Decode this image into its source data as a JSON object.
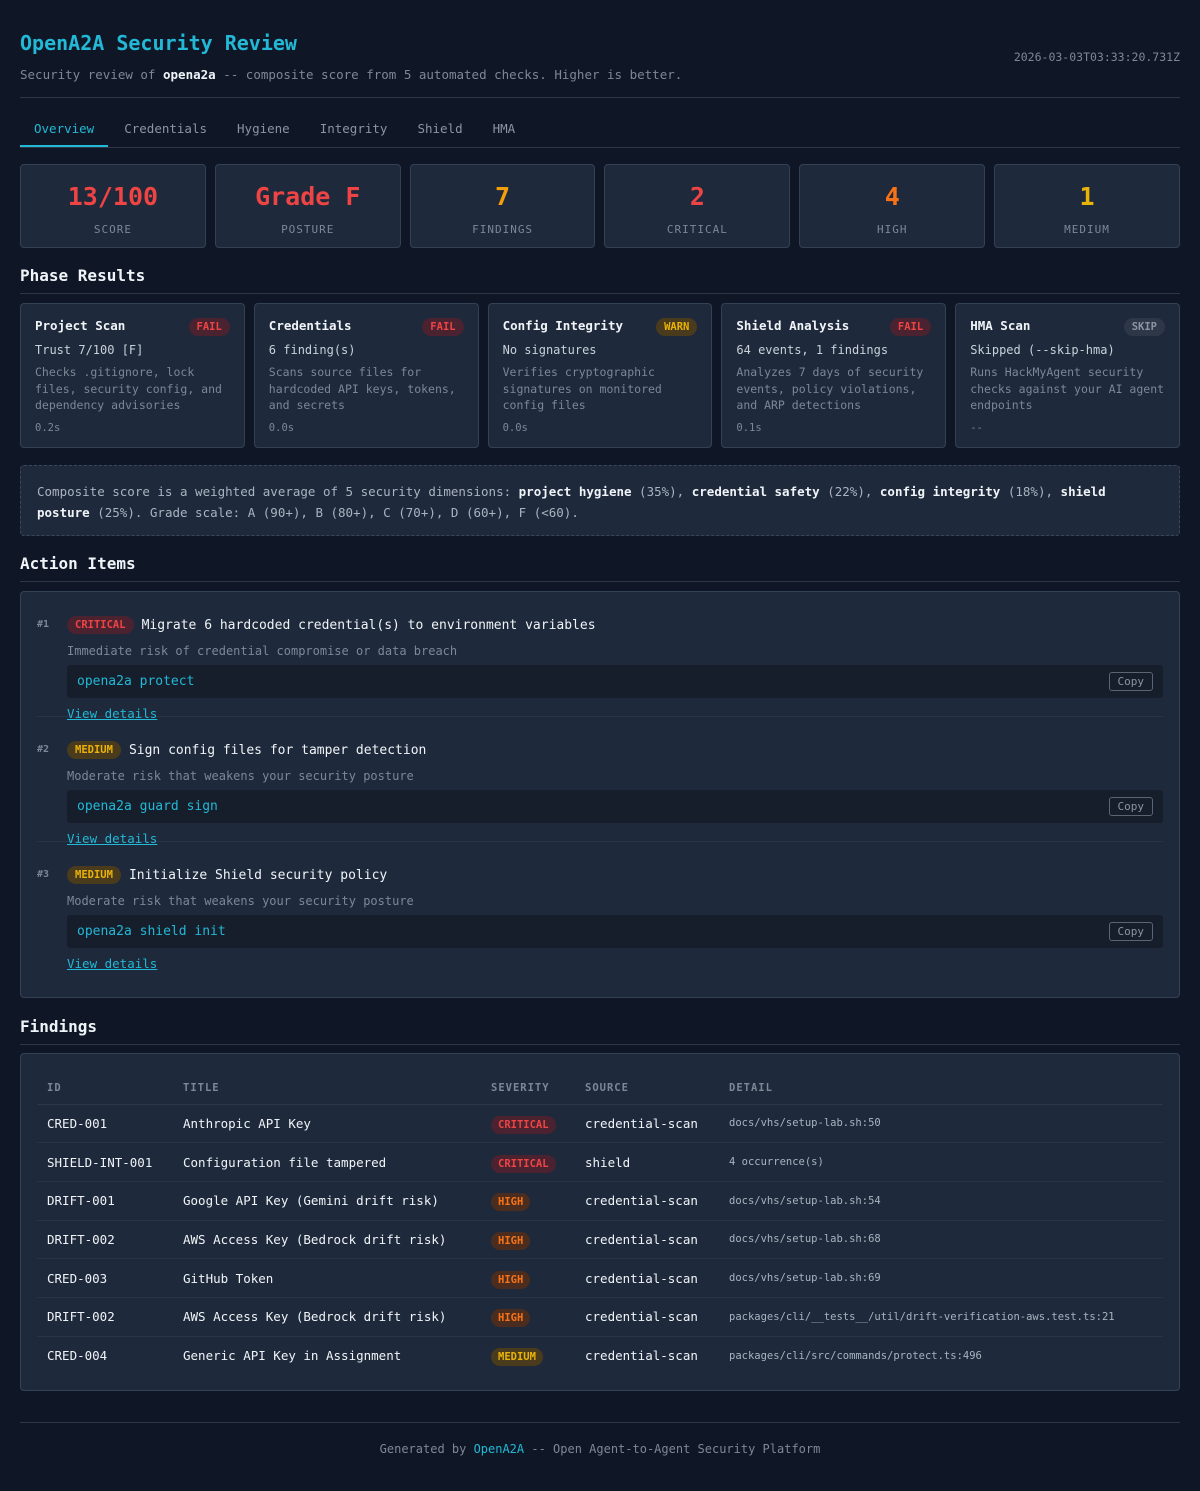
{
  "header": {
    "title": "OpenA2A Security Review",
    "subtitle_prefix": "Security review of ",
    "subtitle_project": "opena2a",
    "subtitle_suffix": " -- composite score from 5 automated checks. Higher is better.",
    "timestamp": "2026-03-03T03:33:20.731Z"
  },
  "tabs": [
    {
      "label": "Overview",
      "active": true
    },
    {
      "label": "Credentials"
    },
    {
      "label": "Hygiene"
    },
    {
      "label": "Integrity"
    },
    {
      "label": "Shield"
    },
    {
      "label": "HMA"
    }
  ],
  "stats": [
    {
      "value": "13/100",
      "label": "SCORE",
      "color": "#ef4444"
    },
    {
      "value": "Grade F",
      "label": "POSTURE",
      "color": "#ef4444"
    },
    {
      "value": "7",
      "label": "FINDINGS",
      "color": "#f59e0b"
    },
    {
      "value": "2",
      "label": "CRITICAL",
      "color": "#ef4444"
    },
    {
      "value": "4",
      "label": "HIGH",
      "color": "#f97316"
    },
    {
      "value": "1",
      "label": "MEDIUM",
      "color": "#eab308"
    }
  ],
  "phase_section_title": "Phase Results",
  "phases": [
    {
      "name": "Project Scan",
      "badge": "FAIL",
      "badge_type": "fail",
      "status": "Trust 7/100 [F]",
      "desc": "Checks .gitignore, lock files, security config, and dependency advisories",
      "time": "0.2s"
    },
    {
      "name": "Credentials",
      "badge": "FAIL",
      "badge_type": "fail",
      "status": "6 finding(s)",
      "desc": "Scans source files for hardcoded API keys, tokens, and secrets",
      "time": "0.0s"
    },
    {
      "name": "Config Integrity",
      "badge": "WARN",
      "badge_type": "warn",
      "status": "No signatures",
      "desc": "Verifies cryptographic signatures on monitored config files",
      "time": "0.0s"
    },
    {
      "name": "Shield Analysis",
      "badge": "FAIL",
      "badge_type": "fail",
      "status": "64 events, 1 findings",
      "desc": "Analyzes 7 days of security events, policy violations, and ARP detections",
      "time": "0.1s"
    },
    {
      "name": "HMA Scan",
      "badge": "SKIP",
      "badge_type": "skip",
      "status": "Skipped (--skip-hma)",
      "desc": "Runs HackMyAgent security checks against your AI agent endpoints",
      "time": "--"
    }
  ],
  "info": {
    "p1": "Composite score is a weighted average of 5 security dimensions: ",
    "d1": "project hygiene",
    "w1": " (35%), ",
    "d2": "credential safety",
    "w2": " (22%), ",
    "d3": "config integrity",
    "w3": " (18%), ",
    "d4": "shield posture",
    "w4": " (25%). Grade scale: A (90+), B (80+), C (70+), D (60+), F (<60)."
  },
  "actions_section_title": "Action Items",
  "actions": [
    {
      "num": "#1",
      "severity": "CRITICAL",
      "sev_type": "crit",
      "title": "Migrate 6 hardcoded credential(s) to environment variables",
      "subtitle": "Immediate risk of credential compromise or data breach",
      "command": "opena2a protect",
      "copy_label": "Copy",
      "link": "View details"
    },
    {
      "num": "#2",
      "severity": "MEDIUM",
      "sev_type": "med",
      "title": "Sign config files for tamper detection",
      "subtitle": "Moderate risk that weakens your security posture",
      "command": "opena2a guard sign",
      "copy_label": "Copy",
      "link": "View details"
    },
    {
      "num": "#3",
      "severity": "MEDIUM",
      "sev_type": "med",
      "title": "Initialize Shield security policy",
      "subtitle": "Moderate risk that weakens your security posture",
      "command": "opena2a shield init",
      "copy_label": "Copy",
      "link": "View details"
    }
  ],
  "findings_section_title": "Findings",
  "findings_columns": [
    "ID",
    "TITLE",
    "SEVERITY",
    "SOURCE",
    "DETAIL"
  ],
  "findings": [
    {
      "id": "CRED-001",
      "title": "Anthropic API Key",
      "severity": "CRITICAL",
      "sev_type": "crit",
      "source": "credential-scan",
      "detail": "docs/vhs/setup-lab.sh:50"
    },
    {
      "id": "SHIELD-INT-001",
      "title": "Configuration file tampered",
      "severity": "CRITICAL",
      "sev_type": "crit",
      "source": "shield",
      "detail": "4 occurrence(s)"
    },
    {
      "id": "DRIFT-001",
      "title": "Google API Key (Gemini drift risk)",
      "severity": "HIGH",
      "sev_type": "high",
      "source": "credential-scan",
      "detail": "docs/vhs/setup-lab.sh:54"
    },
    {
      "id": "DRIFT-002",
      "title": "AWS Access Key (Bedrock drift risk)",
      "severity": "HIGH",
      "sev_type": "high",
      "source": "credential-scan",
      "detail": "docs/vhs/setup-lab.sh:68"
    },
    {
      "id": "CRED-003",
      "title": "GitHub Token",
      "severity": "HIGH",
      "sev_type": "high",
      "source": "credential-scan",
      "detail": "docs/vhs/setup-lab.sh:69"
    },
    {
      "id": "DRIFT-002",
      "title": "AWS Access Key (Bedrock drift risk)",
      "severity": "HIGH",
      "sev_type": "high",
      "source": "credential-scan",
      "detail": "packages/cli/__tests__/util/drift-verification-aws.test.ts:21"
    },
    {
      "id": "CRED-004",
      "title": "Generic API Key in Assignment",
      "severity": "MEDIUM",
      "sev_type": "med",
      "source": "credential-scan",
      "detail": "packages/cli/src/commands/protect.ts:496"
    }
  ],
  "footer": {
    "prefix": "Generated by ",
    "brand": "OpenA2A",
    "suffix": " -- Open Agent-to-Agent Security Platform"
  }
}
